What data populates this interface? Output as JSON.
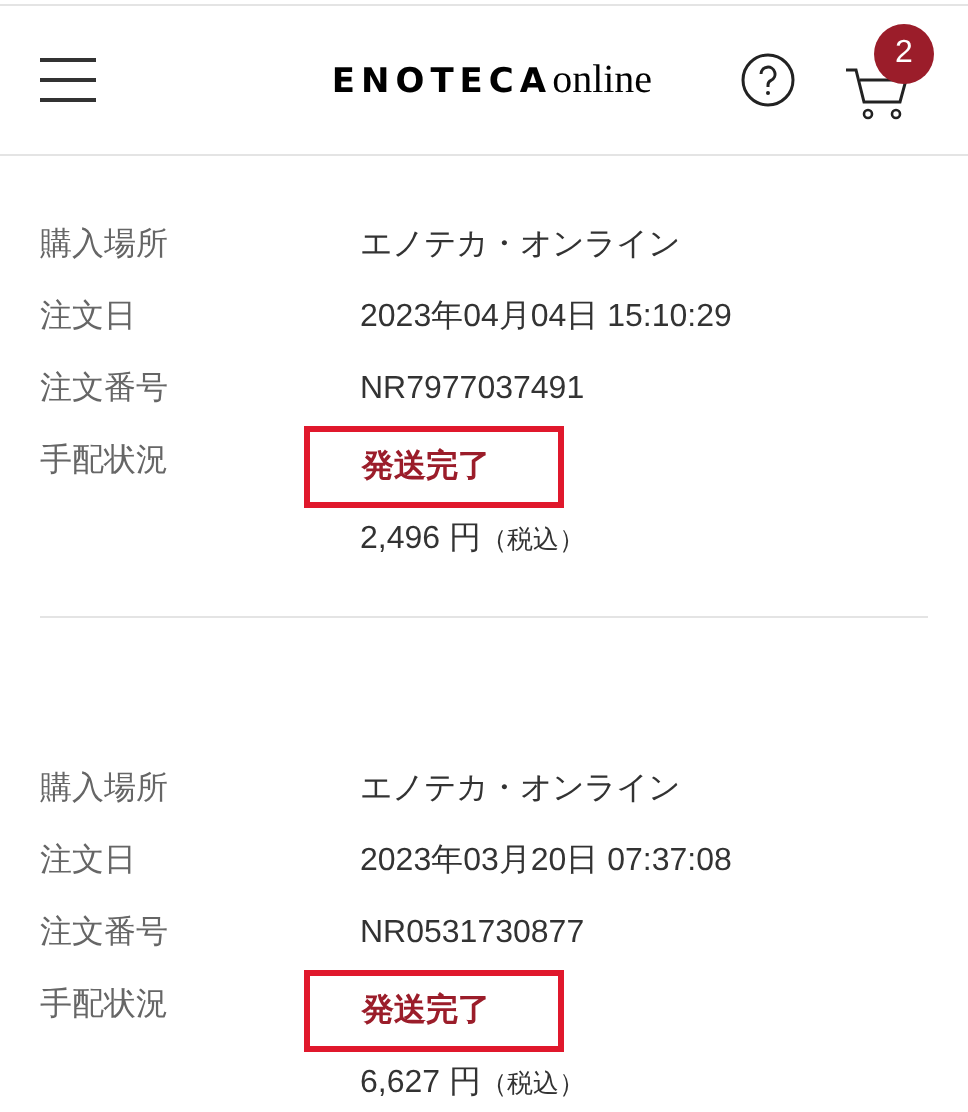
{
  "header": {
    "logo": {
      "brand": "ENOTECA",
      "suffix": "online"
    },
    "cart_count": "2"
  },
  "orders": [
    {
      "fields": [
        {
          "label": "購入場所",
          "value": "エノテカ・オンライン"
        },
        {
          "label": "注文日",
          "value": "2023年04月04日 15:10:29"
        },
        {
          "label": "注文番号",
          "value": "NR7977037491"
        }
      ],
      "status_label": "手配状況",
      "status": "発送完了",
      "highlighted": true,
      "price": "2,496 円",
      "tax_note": "（税込）"
    },
    {
      "fields": [
        {
          "label": "購入場所",
          "value": "エノテカ・オンライン"
        },
        {
          "label": "注文日",
          "value": "2023年03月20日 07:37:08"
        },
        {
          "label": "注文番号",
          "value": "NR0531730877"
        }
      ],
      "status_label": "手配状況",
      "status": "発送完了",
      "highlighted": true,
      "price": "6,627 円",
      "tax_note": "（税込）"
    }
  ]
}
